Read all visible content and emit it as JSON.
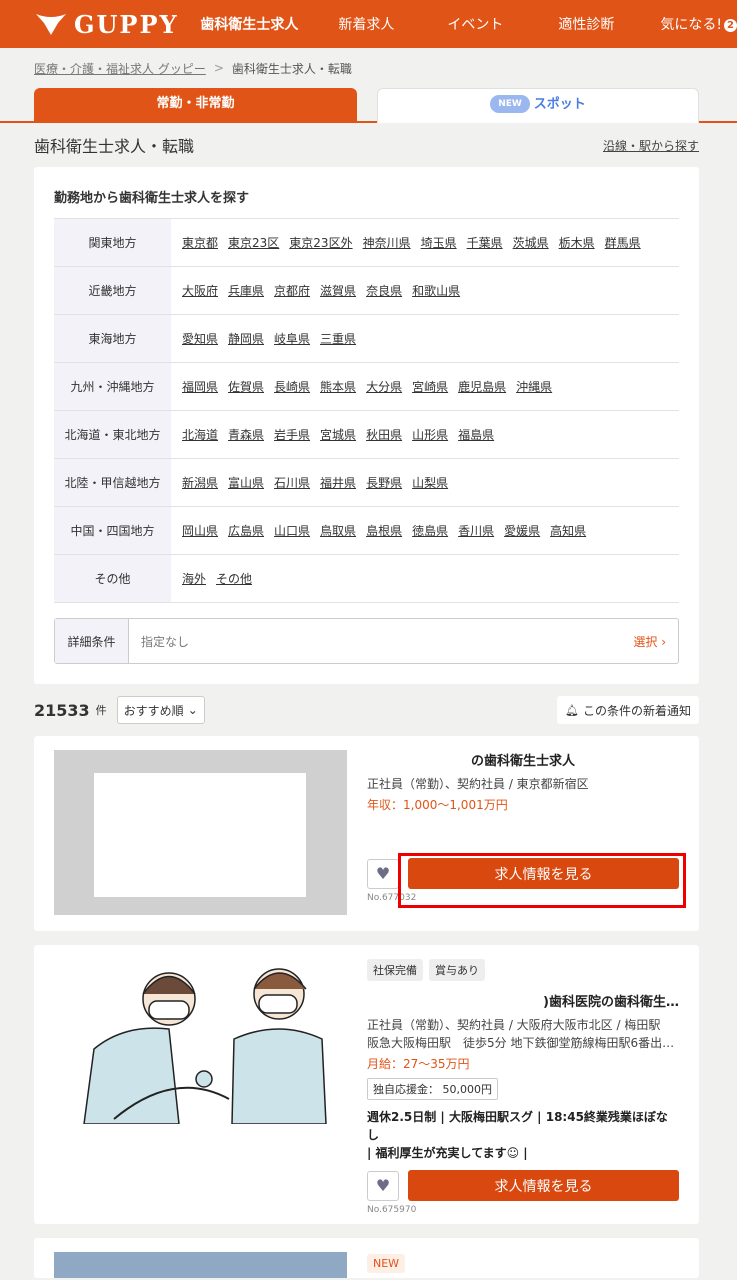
{
  "header": {
    "logo": "GUPPY",
    "nav": [
      "歯科衛生士求人",
      "新着求人",
      "イベント",
      "適性診断",
      "気になる!"
    ],
    "fav_count": "2"
  },
  "breadcrumb": {
    "home": "医療・介護・福祉求人 グッピー",
    "current": "歯科衛生士求人・転職"
  },
  "tabs": {
    "regular": "常勤・非常勤",
    "new_badge": "NEW",
    "spot": "スポット"
  },
  "page": {
    "title": "歯科衛生士求人・転職",
    "route_link": "沿線・駅から探す"
  },
  "search": {
    "heading": "勤務地から歯科衛生士求人を探す",
    "regions": [
      {
        "name": "関東地方",
        "prefs": [
          "東京都",
          "東京23区",
          "東京23区外",
          "神奈川県",
          "埼玉県",
          "千葉県",
          "茨城県",
          "栃木県",
          "群馬県"
        ]
      },
      {
        "name": "近畿地方",
        "prefs": [
          "大阪府",
          "兵庫県",
          "京都府",
          "滋賀県",
          "奈良県",
          "和歌山県"
        ]
      },
      {
        "name": "東海地方",
        "prefs": [
          "愛知県",
          "静岡県",
          "岐阜県",
          "三重県"
        ]
      },
      {
        "name": "九州・沖縄地方",
        "prefs": [
          "福岡県",
          "佐賀県",
          "長崎県",
          "熊本県",
          "大分県",
          "宮崎県",
          "鹿児島県",
          "沖縄県"
        ]
      },
      {
        "name": "北海道・東北地方",
        "prefs": [
          "北海道",
          "青森県",
          "岩手県",
          "宮城県",
          "秋田県",
          "山形県",
          "福島県"
        ]
      },
      {
        "name": "北陸・甲信越地方",
        "prefs": [
          "新潟県",
          "富山県",
          "石川県",
          "福井県",
          "長野県",
          "山梨県"
        ]
      },
      {
        "name": "中国・四国地方",
        "prefs": [
          "岡山県",
          "広島県",
          "山口県",
          "鳥取県",
          "島根県",
          "徳島県",
          "香川県",
          "愛媛県",
          "高知県"
        ]
      },
      {
        "name": "その他",
        "prefs": [
          "海外",
          "その他"
        ]
      }
    ],
    "detail_label": "詳細条件",
    "detail_value": "指定なし",
    "detail_select": "選択"
  },
  "results": {
    "count": "21533",
    "unit": "件",
    "sort": "おすすめ順",
    "notify": "この条件の新着通知"
  },
  "jobs": [
    {
      "title": "の歯科衛生士求人",
      "meta": "正社員（常勤）、契約社員 / 東京都新宿区",
      "salary": "年収：1,000〜1,001万円",
      "button": "求人情報を見る",
      "no": "No.677032"
    },
    {
      "tags": [
        "社保完備",
        "賞与あり"
      ],
      "title": ")歯科医院の歯科衛生…",
      "meta1": "正社員（常勤）、契約社員 / 大阪府大阪市北区 / 梅田駅",
      "meta2": "阪急大阪梅田駅　徒歩5分 地下鉄御堂筋線梅田駅6番出…",
      "salary": "月給：27〜35万円",
      "bonus": "独自応援金： 50,000円",
      "pitch1": "週休2.5日制 | 大阪梅田駅スグ | 18:45終業残業ほぼなし",
      "pitch2": "| 福利厚生が充実してます☺ |",
      "button": "求人情報を見る",
      "no": "No.675970"
    },
    {
      "new": "NEW"
    }
  ]
}
